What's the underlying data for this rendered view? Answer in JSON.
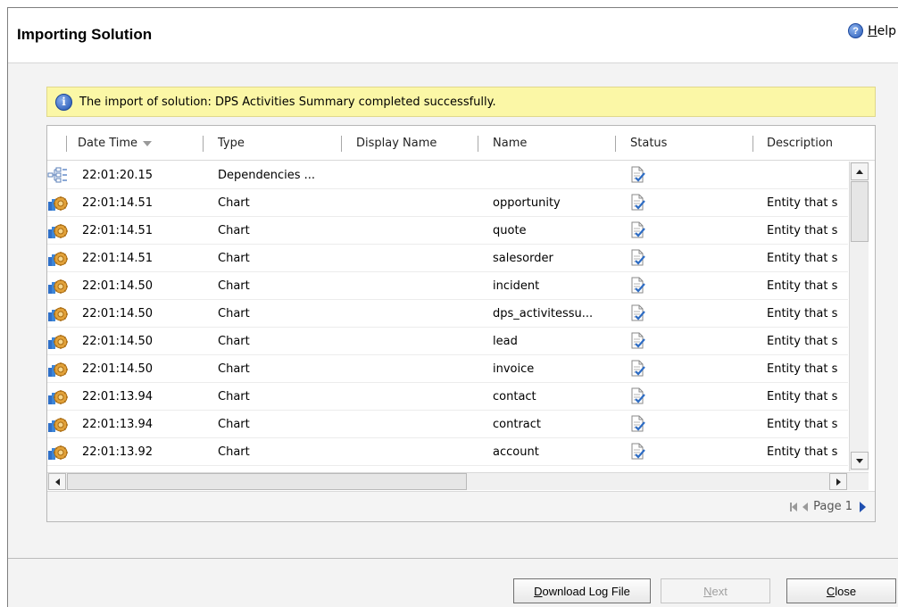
{
  "dialog": {
    "title": "Importing Solution",
    "help_label_first": "H",
    "help_label_rest": "elp"
  },
  "info": {
    "message": "The import of solution: DPS Activities Summary completed successfully."
  },
  "grid": {
    "columns": [
      "Date Time",
      "Type",
      "Display Name",
      "Name",
      "Status",
      "Description"
    ],
    "rows": [
      {
        "icon": "dependencies-icon",
        "datetime": "22:01:20.15",
        "type": "Dependencies ...",
        "display_name": "",
        "name": "",
        "status_icon": "success-status-icon",
        "description": ""
      },
      {
        "icon": "chart-component-icon",
        "datetime": "22:01:14.51",
        "type": "Chart",
        "display_name": "",
        "name": "opportunity",
        "status_icon": "success-status-icon",
        "description": "Entity that s"
      },
      {
        "icon": "chart-component-icon",
        "datetime": "22:01:14.51",
        "type": "Chart",
        "display_name": "",
        "name": "quote",
        "status_icon": "success-status-icon",
        "description": "Entity that s"
      },
      {
        "icon": "chart-component-icon",
        "datetime": "22:01:14.51",
        "type": "Chart",
        "display_name": "",
        "name": "salesorder",
        "status_icon": "success-status-icon",
        "description": "Entity that s"
      },
      {
        "icon": "chart-component-icon",
        "datetime": "22:01:14.50",
        "type": "Chart",
        "display_name": "",
        "name": "incident",
        "status_icon": "success-status-icon",
        "description": "Entity that s"
      },
      {
        "icon": "chart-component-icon",
        "datetime": "22:01:14.50",
        "type": "Chart",
        "display_name": "",
        "name": "dps_activitessu...",
        "status_icon": "success-status-icon",
        "description": "Entity that s"
      },
      {
        "icon": "chart-component-icon",
        "datetime": "22:01:14.50",
        "type": "Chart",
        "display_name": "",
        "name": "lead",
        "status_icon": "success-status-icon",
        "description": "Entity that s"
      },
      {
        "icon": "chart-component-icon",
        "datetime": "22:01:14.50",
        "type": "Chart",
        "display_name": "",
        "name": "invoice",
        "status_icon": "success-status-icon",
        "description": "Entity that s"
      },
      {
        "icon": "chart-component-icon",
        "datetime": "22:01:13.94",
        "type": "Chart",
        "display_name": "",
        "name": "contact",
        "status_icon": "success-status-icon",
        "description": "Entity that s"
      },
      {
        "icon": "chart-component-icon",
        "datetime": "22:01:13.94",
        "type": "Chart",
        "display_name": "",
        "name": "contract",
        "status_icon": "success-status-icon",
        "description": "Entity that s"
      },
      {
        "icon": "chart-component-icon",
        "datetime": "22:01:13.92",
        "type": "Chart",
        "display_name": "",
        "name": "account",
        "status_icon": "success-status-icon",
        "description": "Entity that s"
      }
    ],
    "pager_label": "Page 1"
  },
  "footer": {
    "download_first": "D",
    "download_rest": "ownload Log File",
    "next_first": "N",
    "next_rest": "ext",
    "close_first": "C",
    "close_rest": "lose"
  },
  "colors": {
    "info_background": "#fbf7a6",
    "dialog_background": "#f3f3f3",
    "accent_blue": "#1f4fb0"
  }
}
